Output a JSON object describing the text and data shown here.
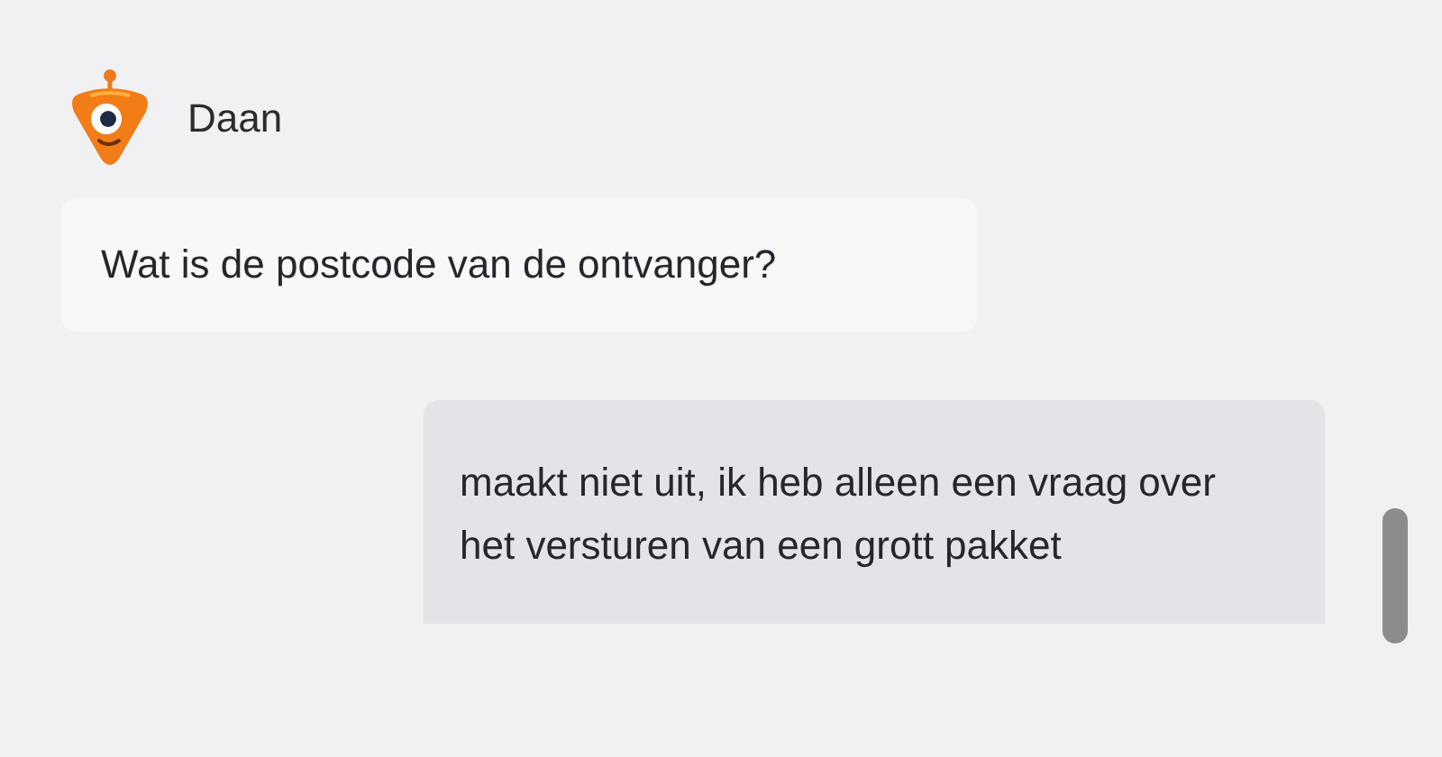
{
  "messages": [
    {
      "kind": "bot",
      "sender": "Daan",
      "text": "Wat is de postcode van de ontvanger?"
    },
    {
      "kind": "user",
      "text": "maakt niet uit, ik heb alleen een vraag over het versturen van een grott pakket"
    }
  ]
}
